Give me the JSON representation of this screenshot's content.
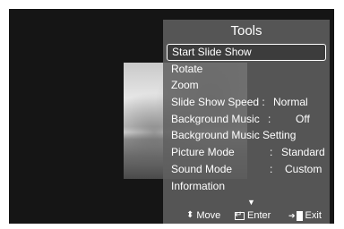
{
  "menu": {
    "title": "Tools",
    "items": [
      {
        "label": "Start Slide Show",
        "value": "",
        "selected": true
      },
      {
        "label": "Rotate",
        "value": ""
      },
      {
        "label": "Zoom",
        "value": ""
      },
      {
        "label": "Slide Show Speed :",
        "value": "Normal"
      },
      {
        "label": "Background Music",
        "sep": ":",
        "value": "Off"
      },
      {
        "label": "Background Music Setting",
        "value": ""
      },
      {
        "label": "Picture Mode",
        "sep": ":",
        "value": "Standard"
      },
      {
        "label": "Sound Mode",
        "sep": ":",
        "value": "Custom"
      },
      {
        "label": "Information",
        "value": ""
      }
    ],
    "more_indicator": "▼"
  },
  "footer": {
    "move_icon": "up-down-arrow-icon",
    "move_label": "Move",
    "enter_icon": "enter-icon",
    "enter_label": "Enter",
    "exit_icon": "exit-icon",
    "exit_label": "Exit"
  },
  "colors": {
    "screen_bg": "#151515",
    "menu_bg": "#5f5f5f",
    "text": "#ffffff"
  }
}
